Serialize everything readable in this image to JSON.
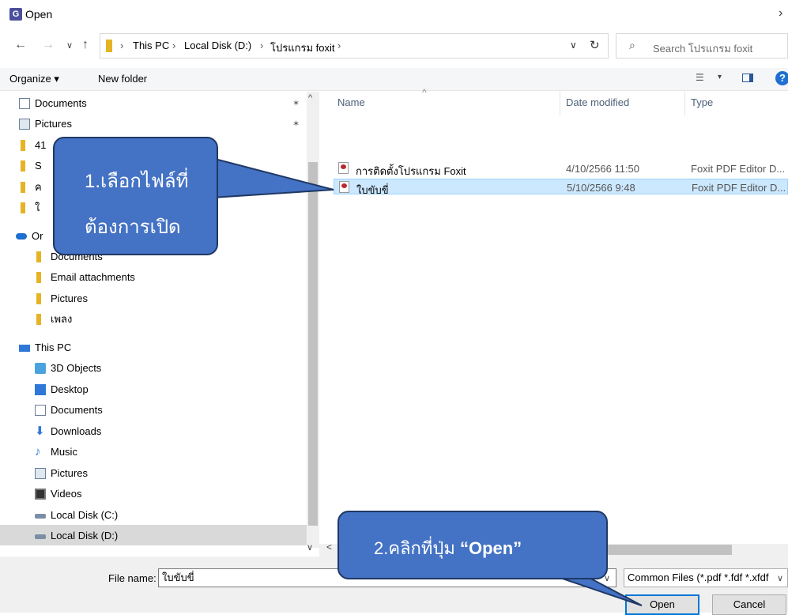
{
  "window": {
    "title": "Open",
    "app_icon_glyph": "G",
    "close_glyph": "›"
  },
  "nav": {
    "back_glyph": "←",
    "forward_glyph": "→",
    "recent_glyph": "∨",
    "up_glyph": "↑",
    "breadcrumbs": [
      "This PC",
      "Local Disk (D:)",
      "โปรแกรม foxit"
    ],
    "crumb_sep": "›",
    "dropdown_glyph": "∨",
    "refresh_glyph": "↻",
    "search_icon_glyph": "⌕",
    "search_placeholder": "Search โปรแกรม foxit"
  },
  "toolbar": {
    "organize_label": "Organize ▾",
    "new_folder_label": "New folder",
    "view_glyph": "☰",
    "view_dd_glyph": "▾",
    "help_glyph": "?"
  },
  "sidebar": {
    "items": [
      {
        "label": "Documents",
        "icon": "document-icon",
        "pinned": true
      },
      {
        "label": "Pictures",
        "icon": "pictures-icon",
        "pinned": true
      },
      {
        "label": "41",
        "icon": "folder-icon"
      },
      {
        "label": "S",
        "icon": "folder-icon"
      },
      {
        "label": "ค",
        "icon": "folder-icon"
      },
      {
        "label": "ใ",
        "icon": "folder-icon"
      },
      {
        "label": "Or",
        "icon": "onedrive-icon"
      },
      {
        "label": "Documents",
        "icon": "folder-icon"
      },
      {
        "label": "Email attachments",
        "icon": "folder-icon"
      },
      {
        "label": "Pictures",
        "icon": "folder-icon"
      },
      {
        "label": "เพลง",
        "icon": "folder-icon"
      },
      {
        "label": "This PC",
        "icon": "this-pc-icon"
      },
      {
        "label": "3D Objects",
        "icon": "3d-objects-icon"
      },
      {
        "label": "Desktop",
        "icon": "desktop-icon"
      },
      {
        "label": "Documents",
        "icon": "document-icon"
      },
      {
        "label": "Downloads",
        "icon": "downloads-icon"
      },
      {
        "label": "Music",
        "icon": "music-icon"
      },
      {
        "label": "Pictures",
        "icon": "pictures-icon"
      },
      {
        "label": "Videos",
        "icon": "videos-icon"
      },
      {
        "label": "Local Disk (C:)",
        "icon": "disk-icon"
      },
      {
        "label": "Local Disk (D:)",
        "icon": "disk-icon",
        "selected": true
      }
    ],
    "pin_glyph": "✶",
    "scroll_up_glyph": "^",
    "scroll_down_glyph": "∨",
    "scroll_left_glyph": "<"
  },
  "file_list": {
    "columns": {
      "name": "Name",
      "date": "Date modified",
      "type": "Type"
    },
    "sort_glyph": "^",
    "files": [
      {
        "name": "การติดตั้งโปรแกรม Foxit",
        "date": "4/10/2566 11:50",
        "type": "Foxit PDF Editor D...",
        "selected": false
      },
      {
        "name": "ใบขับขี่",
        "date": "5/10/2566 9:48",
        "type": "Foxit PDF Editor D...",
        "selected": true
      }
    ]
  },
  "bottom": {
    "file_name_label": "File name:",
    "file_name_value": "ใบขับขี่",
    "file_type_value": "Common Files (*.pdf *.fdf *.xfdf",
    "dd_glyph": "∨",
    "open_label": "Open",
    "cancel_label": "Cancel"
  },
  "callouts": {
    "step1_line1": "1.เลือกไฟล์ที่",
    "step1_line2": "ต้องการเปิด",
    "step2_prefix": "2.คลิกที่ปุ่ม ",
    "step2_button": "“Open”"
  },
  "colors": {
    "callout_fill": "#4472c4",
    "callout_border": "#1f3864",
    "selection": "#cce8ff",
    "accent": "#0078d7"
  }
}
